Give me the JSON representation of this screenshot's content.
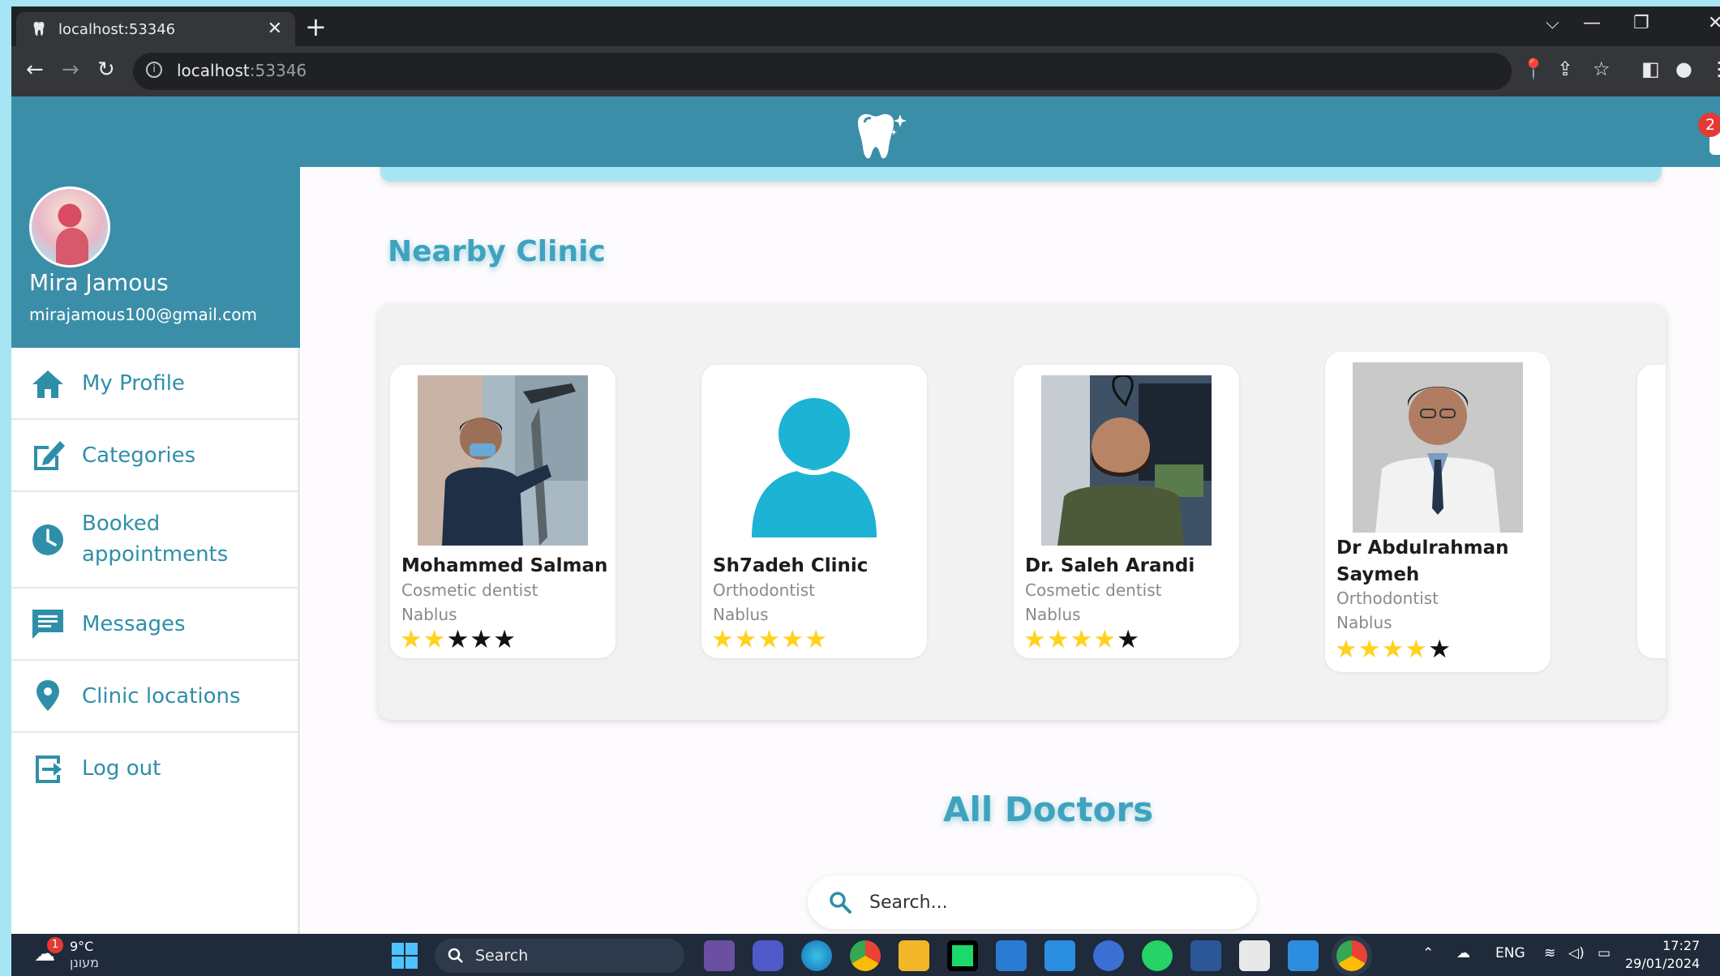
{
  "browser": {
    "tab_title": "localhost:53346",
    "url_host": "localhost",
    "url_port": ":53346"
  },
  "header": {
    "notification_count": "2"
  },
  "user": {
    "name": "Mira Jamous",
    "email": "mirajamous100@gmail.com"
  },
  "menu": [
    {
      "label": "My Profile",
      "icon": "home-icon"
    },
    {
      "label": "Categories",
      "icon": "edit-icon"
    },
    {
      "label": "Booked appointments",
      "icon": "clock-icon"
    },
    {
      "label": "Messages",
      "icon": "message-icon"
    },
    {
      "label": "Clinic locations",
      "icon": "location-pin-icon"
    },
    {
      "label": "Log out",
      "icon": "logout-icon"
    }
  ],
  "nearby": {
    "title": "Nearby Clinic",
    "cards": [
      {
        "name": "Mohammed Salman",
        "specialty": "Cosmetic dentist",
        "city": "Nablus",
        "rating": 2
      },
      {
        "name": "Sh7adeh Clinic",
        "specialty": "Orthodontist",
        "city": "Nablus",
        "rating": 5
      },
      {
        "name": "Dr. Saleh Arandi",
        "specialty": "Cosmetic dentist",
        "city": "Nablus",
        "rating": 4
      },
      {
        "name": "Dr Abdulrahman Saymeh",
        "specialty": "Orthodontist",
        "city": "Nablus",
        "rating": 4
      }
    ]
  },
  "all_doctors": {
    "title": "All Doctors",
    "search_placeholder": "Search..."
  },
  "taskbar": {
    "weather_temp": "9°C",
    "weather_desc": "מעונן",
    "weather_badge": "1",
    "search_label": "Search",
    "language": "ENG",
    "time": "17:27",
    "date": "29/01/2024"
  },
  "colors": {
    "primary": "#3b8ea8",
    "accent_text": "#3fa3bf",
    "star_on": "#ffd21f",
    "page_border": "#a6e5f4"
  }
}
